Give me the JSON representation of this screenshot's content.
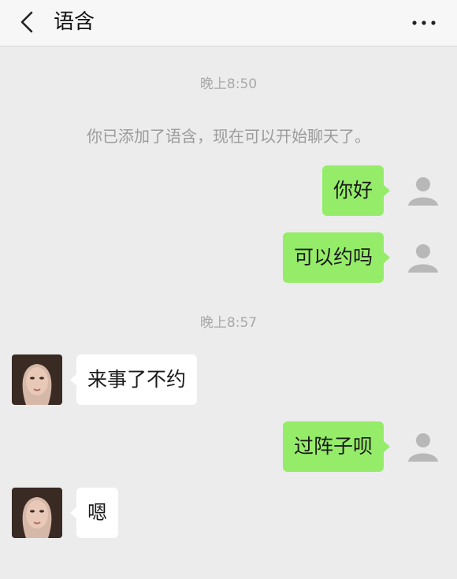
{
  "header": {
    "back_icon": "chevron-left-icon",
    "title": "语含",
    "more_icon": "more-dots-icon"
  },
  "chat": {
    "timestamps": [
      "晚上8:50",
      "晚上8:57"
    ],
    "system_message": "你已添加了语含，现在可以开始聊天了。",
    "messages": [
      {
        "sender": "me",
        "text": "你好"
      },
      {
        "sender": "me",
        "text": "可以约吗"
      },
      {
        "sender": "contact",
        "text": "来事了不约"
      },
      {
        "sender": "me",
        "text": "过阵子呗"
      },
      {
        "sender": "contact",
        "text": "嗯"
      }
    ]
  },
  "colors": {
    "sent_bubble": "#95ec69",
    "received_bubble": "#ffffff",
    "background": "#ececec",
    "header_background": "#f7f7f7"
  }
}
